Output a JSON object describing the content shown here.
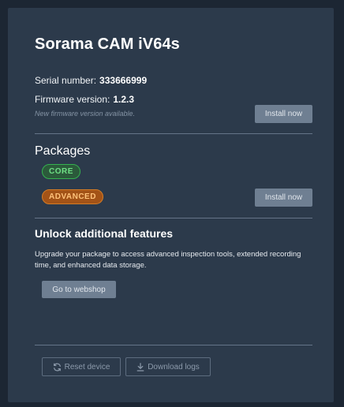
{
  "device": {
    "title": "Sorama CAM iV64s",
    "serial_label": "Serial number:",
    "serial_value": "333666999",
    "firmware_label": "Firmware version:",
    "firmware_value": "1.2.3",
    "firmware_notice": "New firmware version available.",
    "firmware_install_label": "Install now"
  },
  "packages": {
    "title": "Packages",
    "items": [
      {
        "label": "CORE",
        "color": "#35b24f"
      },
      {
        "label": "ADVANCED",
        "color": "#d47c26"
      }
    ],
    "install_label": "Install now"
  },
  "unlock": {
    "title": "Unlock additional features",
    "description": "Upgrade your package to access advanced inspection tools, extended recording time, and enhanced data storage.",
    "webshop_label": "Go to webshop"
  },
  "footer": {
    "reset_label": "Reset device",
    "reset_icon": "refresh-icon",
    "download_label": "Download logs",
    "download_icon": "download-icon"
  }
}
